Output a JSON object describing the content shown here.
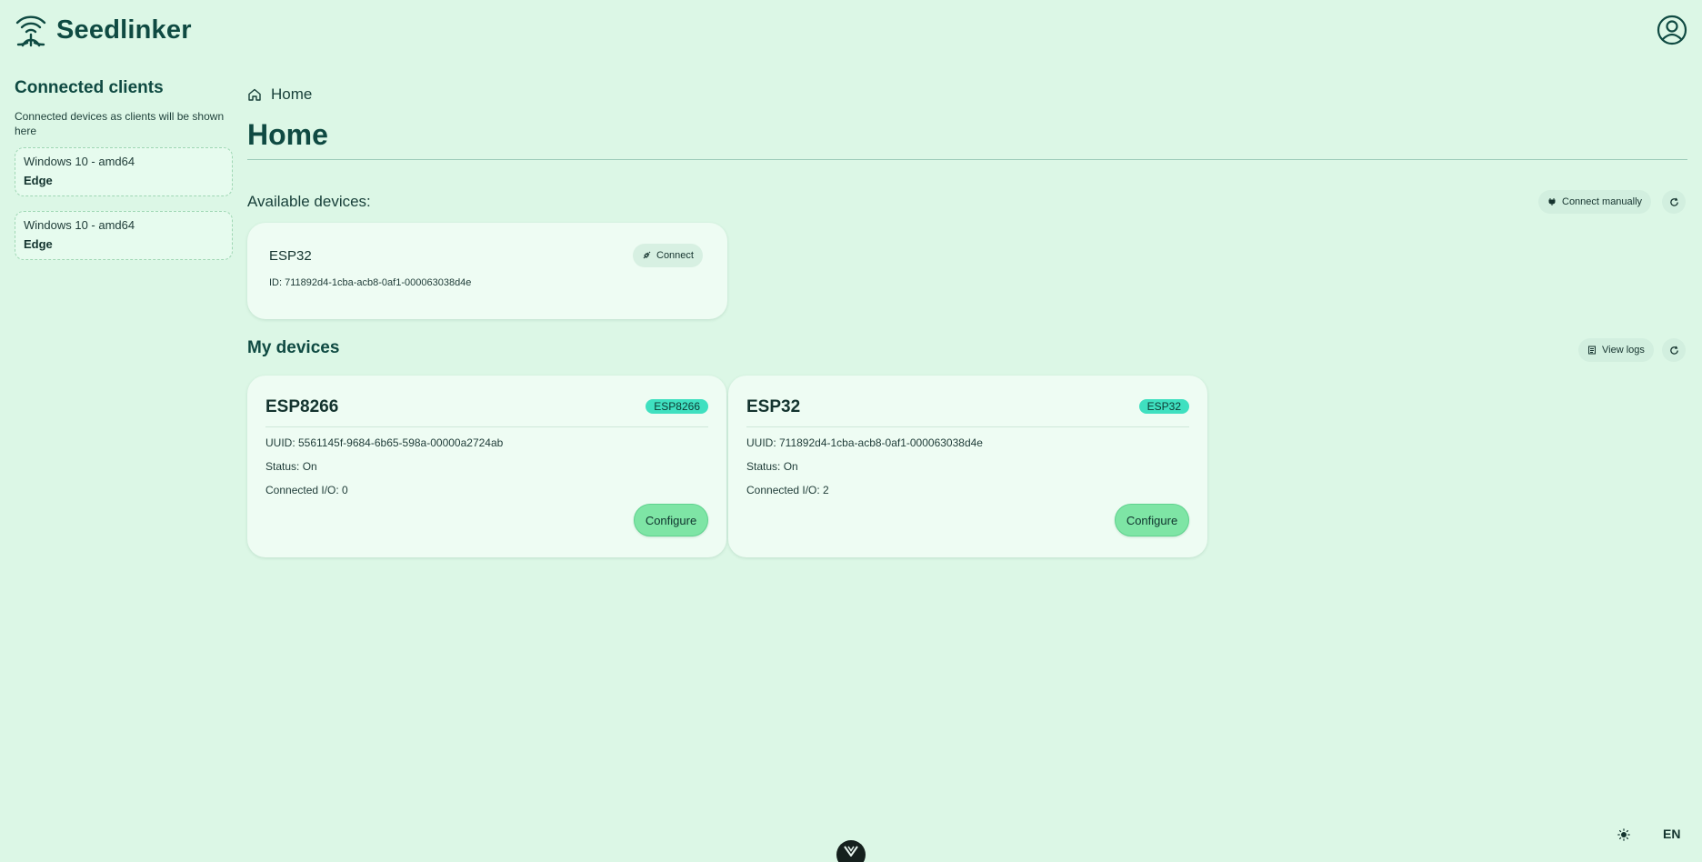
{
  "app": {
    "brand": "Seedlinker"
  },
  "sidebar": {
    "title": "Connected clients",
    "description": "Connected devices as clients will be shown here",
    "clients": [
      {
        "os": "Windows 10 - amd64",
        "browser": "Edge"
      },
      {
        "os": "Windows 10 - amd64",
        "browser": "Edge"
      }
    ]
  },
  "breadcrumb": {
    "label": "Home"
  },
  "page": {
    "title": "Home"
  },
  "available": {
    "title": "Available devices:",
    "connect_manually_label": "Connect manually",
    "devices": [
      {
        "name": "ESP32",
        "id_text": "ID: 711892d4-1cba-acb8-0af1-000063038d4e",
        "connect_label": "Connect"
      }
    ]
  },
  "my_devices": {
    "title": "My devices",
    "view_logs_label": "View logs",
    "devices": [
      {
        "name": "ESP8266",
        "badge": "ESP8266",
        "uuid": "UUID: 5561145f-9684-6b65-598a-00000a2724ab",
        "status": "Status: On",
        "connected_io": "Connected I/O: 0",
        "configure_label": "Configure"
      },
      {
        "name": "ESP32",
        "badge": "ESP32",
        "uuid": "UUID: 711892d4-1cba-acb8-0af1-000063038d4e",
        "status": "Status: On",
        "connected_io": "Connected I/O: 2",
        "configure_label": "Configure"
      }
    ]
  },
  "footer": {
    "language": "EN"
  },
  "icons": {
    "logo": "seedling-wifi-icon",
    "account": "user-circle-icon",
    "home": "home-icon",
    "connect": "plug-icon",
    "refresh": "refresh-icon",
    "logs": "logs-icon",
    "theme": "sun-icon",
    "devtools": "vue-icon"
  },
  "colors": {
    "background": "#dcf7e6",
    "primary_text": "#0f4a42",
    "badge": "#3fe0c0",
    "configure_button": "#7ee5a5"
  }
}
